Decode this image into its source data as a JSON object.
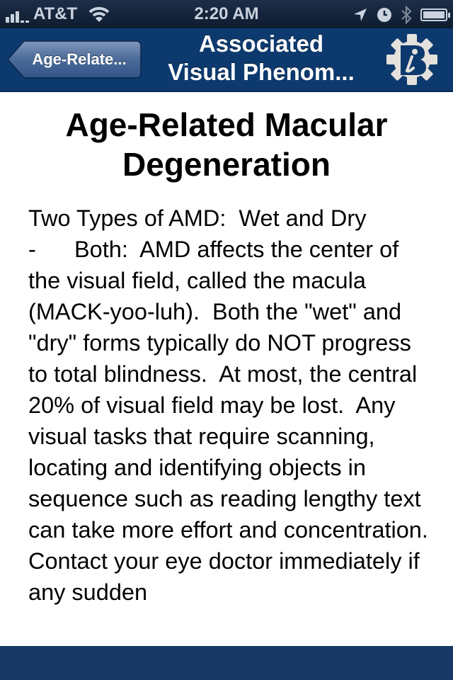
{
  "status_bar": {
    "carrier": "AT&T",
    "time": "2:20 AM",
    "signal_bars": 3,
    "signal_bars_total": 5,
    "battery_level": 0.95
  },
  "nav_bar": {
    "back_label": "Age-Relate...",
    "title_line1": "Associated",
    "title_line2": "Visual Phenom...",
    "info_button_icon": "gear-info-icon"
  },
  "content": {
    "heading_line1": "Age-Related Macular",
    "heading_line2": "Degeneration",
    "body": "Two Types of AMD:  Wet and Dry\n-      Both:  AMD affects the center of the visual field, called the macula (MACK-yoo-luh).  Both the \"wet\" and \"dry\" forms typically do NOT progress to total blindness.  At most, the central 20% of visual field may be lost.  Any visual tasks that require scanning, locating and identifying objects in sequence such as reading lengthy text can take more effort and concentration.  Contact your eye doctor immediately if any sudden"
  },
  "colors": {
    "nav_bg": "#0d3a6e",
    "bottom_bar": "#173864",
    "status_bg": "#14243a"
  }
}
